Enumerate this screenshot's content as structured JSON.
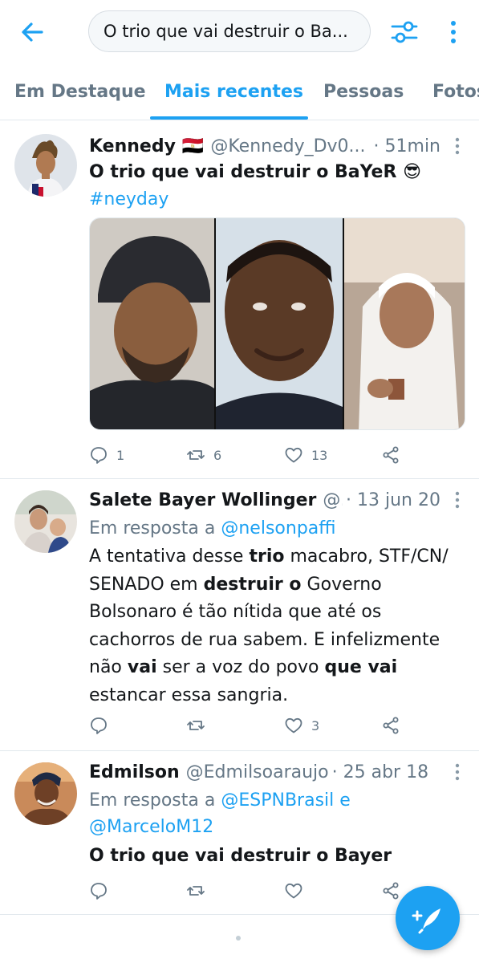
{
  "search": {
    "query": "O trio que vai destruir o Ba..."
  },
  "tabs": [
    {
      "label": "Em Destaque"
    },
    {
      "label": "Mais recentes"
    },
    {
      "label": "Pessoas"
    },
    {
      "label": "Fotos"
    }
  ],
  "tweets": [
    {
      "name": "Kennedy",
      "flag": "🇪🇬",
      "handle": "@Kennedy_Dv0...",
      "time": "· 51min",
      "text": "O trio que vai destruir o BaYeR 😎",
      "hashtag": "#neyday",
      "replies": "1",
      "retweets": "6",
      "likes": "13"
    },
    {
      "name": "Salete Bayer Wollinger",
      "handle": "@...",
      "time": "· 13 jun 20",
      "reply_prefix": "Em resposta a ",
      "reply_to": "@nelsonpaffi",
      "text_parts": [
        "A tentativa desse ",
        "trio",
        " macabro, STF/CN/ SENADO  em ",
        "destruir o",
        " Governo Bolsonaro é tão nítida que até os cachorros de rua sabem. E infelizmente não ",
        "vai",
        " ser a voz do povo ",
        "que vai",
        " estancar essa sangria."
      ],
      "replies": "",
      "retweets": "",
      "likes": "3"
    },
    {
      "name": "Edmilson",
      "handle": "@Edmilsoaraujo",
      "time": "· 25 abr 18",
      "reply_prefix": "Em resposta a ",
      "reply_to_1": "@ESPNBrasil",
      "reply_and": " e",
      "reply_to_2": "@MarceloM12",
      "text": "O trio que vai destruir o Bayer",
      "replies": "",
      "retweets": "",
      "likes": ""
    }
  ],
  "colors": {
    "accent": "#1da1f2",
    "muted": "#657786",
    "divider": "#e1e8ed"
  },
  "icons": [
    "back-arrow-icon",
    "filter-icon",
    "more-vertical-icon",
    "reply-icon",
    "retweet-icon",
    "like-icon",
    "share-icon",
    "compose-icon"
  ]
}
